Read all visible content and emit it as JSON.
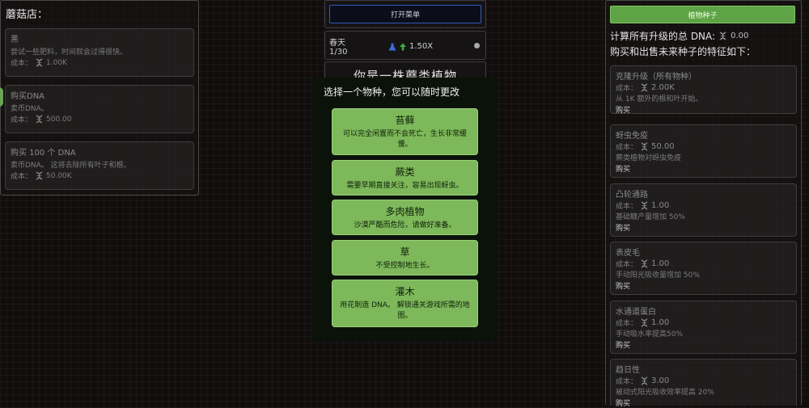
{
  "shop": {
    "title": "蘑菇店：",
    "cards": [
      {
        "name": "黑",
        "desc": "尝试一些肥料，时间就会过得很快。",
        "cost_label": "成本：",
        "cost": "1.00K"
      },
      {
        "name": "购买DNA",
        "desc": "卖币DNA。",
        "cost_label": "成本：",
        "cost": "500.00"
      },
      {
        "name": "购买 100 个 DNA",
        "desc": "卖币DNA。 这将去除所有叶子和根。",
        "cost_label": "成本：",
        "cost": "50.00K"
      }
    ]
  },
  "center": {
    "menu_button": "打开菜单",
    "season": "春天",
    "day": "1/30",
    "rate": "1.50X",
    "species_header": "你是一株蘑类植物"
  },
  "modal": {
    "title": "选择一个物种，您可以随时更改",
    "choices": [
      {
        "name": "苔藓",
        "desc": "可以完全闲置而不会死亡，生长非常缓慢。"
      },
      {
        "name": "蕨类",
        "desc": "需要早期直接关注，容易出现蚜虫。"
      },
      {
        "name": "多肉植物",
        "desc": "沙漠严酷而危险，请做好准备。"
      },
      {
        "name": "草",
        "desc": "不受控制地生长。"
      },
      {
        "name": "灌木",
        "desc": "用花制造 DNA。 解锁通关游戏所需的地图。"
      }
    ]
  },
  "right": {
    "seed_button": "植物种子",
    "total_label": "计算所有升级的总 DNA:",
    "total_value": "0.00",
    "subheading": "购买和出售未来种子的特征如下：",
    "upgrades": [
      {
        "name": "克隆升级（所有物种）",
        "cost_label": "成本：",
        "cost": "2.00K",
        "desc": "从 1K 额外的根和叶开始。",
        "buy": "购买"
      },
      {
        "name": "蚜虫免疫",
        "cost_label": "成本：",
        "cost": "50.00",
        "desc": "蕨类植物对蚜虫免疫",
        "buy": "购买"
      },
      {
        "name": "凸轮通路",
        "cost_label": "成本：",
        "cost": "1.00",
        "desc": "基础糖产量增加 50%",
        "buy": "购买"
      },
      {
        "name": "表皮毛",
        "cost_label": "成本：",
        "cost": "1.00",
        "desc": "手动阳光吸收量增加 50%",
        "buy": "购买"
      },
      {
        "name": "水通道蛋白",
        "cost_label": "成本：",
        "cost": "1.00",
        "desc": "手动吸水率提高50%",
        "buy": "购买"
      },
      {
        "name": "趋日性",
        "cost_label": "成本：",
        "cost": "3.00",
        "desc": "被动式阳光吸收效率提高 20%",
        "buy": "购买"
      }
    ]
  },
  "icons": {
    "dna": "dna-helix-icon",
    "arrow": "up-arrow-icon",
    "info": "info-icon",
    "flask": "flask-icon"
  },
  "colors": {
    "accent_green": "#7db85a",
    "menu_border": "#3458b8",
    "seed_button": "#5ea346"
  }
}
